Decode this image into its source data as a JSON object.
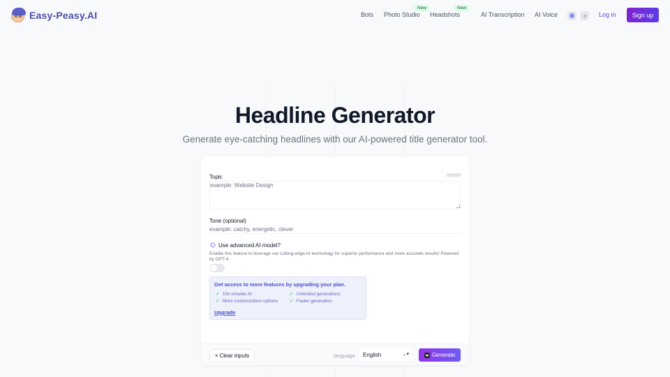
{
  "brand": {
    "name": "Easy-Peasy.AI",
    "logo_icon": "mascot-icon"
  },
  "nav": {
    "items": [
      {
        "label": "Bots",
        "badge": null
      },
      {
        "label": "Photo Studio",
        "badge": "New"
      },
      {
        "label": "Headshots",
        "badge": "New"
      },
      {
        "label": "AI Transcription",
        "badge": null
      },
      {
        "label": "AI Voice",
        "badge": null
      }
    ],
    "theme_icons": [
      "color-theme-icon",
      "sun-icon"
    ],
    "login_label": "Log in",
    "signup_label": "Sign up"
  },
  "hero": {
    "title": "Headline Generator",
    "subtitle": "Generate eye-catching headlines with our AI-powered title generator tool."
  },
  "form": {
    "topic": {
      "label": "Topic",
      "placeholder": "example: Website Design",
      "value": "",
      "counter": "0/1000"
    },
    "tone": {
      "label": "Tone (optional)",
      "placeholder": "example: catchy, energetic, clever",
      "value": ""
    },
    "advanced": {
      "label": "Use advanced AI model?",
      "description": "Enable this feature to leverage our cutting-edge AI technology for superior performance and more accurate results! Powered by GPT-4.",
      "enabled": false
    },
    "upgrade": {
      "title": "Get access to more features by upgrading your plan.",
      "features": [
        "10x smarter AI",
        "Unlimited generations",
        "More customization options",
        "Faster generation"
      ],
      "link_label": "Upgrade"
    }
  },
  "footer": {
    "clear_label": "Clear inputs",
    "clear_icon": "×",
    "language_label": "language",
    "language_value": "English",
    "generate_label": "Generate"
  },
  "colors": {
    "accent": "#5b3de6",
    "brand": "#4a4fa8",
    "success": "#22c55e"
  }
}
